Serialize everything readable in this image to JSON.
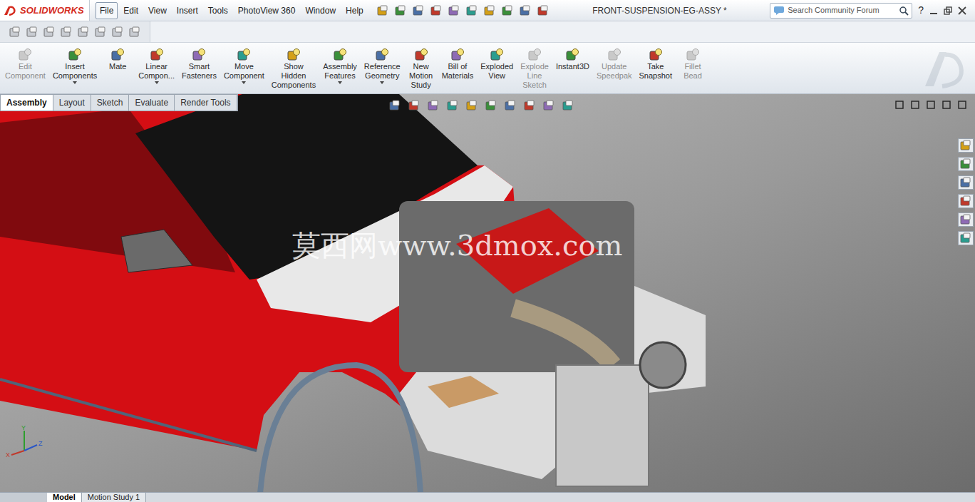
{
  "app": {
    "logo": "SOLIDWORKS"
  },
  "window": {
    "title": "FRONT-SUSPENSION-EG-ASSY *"
  },
  "menu": [
    {
      "label": "File",
      "selected": true
    },
    {
      "label": "Edit",
      "selected": false
    },
    {
      "label": "View",
      "selected": false
    },
    {
      "label": "Insert",
      "selected": false
    },
    {
      "label": "Tools",
      "selected": false
    },
    {
      "label": "PhotoView 360",
      "selected": false
    },
    {
      "label": "Window",
      "selected": false
    },
    {
      "label": "Help",
      "selected": false
    }
  ],
  "search": {
    "placeholder": "Search Community Forum"
  },
  "help": "?",
  "commands": [
    {
      "lines": [
        "Edit",
        "Component"
      ],
      "disabled": true,
      "dropdown": false
    },
    {
      "lines": [
        "Insert",
        "Components"
      ],
      "disabled": false,
      "dropdown": true
    },
    {
      "lines": [
        "Mate"
      ],
      "disabled": false,
      "dropdown": false
    },
    {
      "lines": [
        "Linear",
        "Compon..."
      ],
      "disabled": false,
      "dropdown": true
    },
    {
      "lines": [
        "Smart",
        "Fasteners"
      ],
      "disabled": false,
      "dropdown": false
    },
    {
      "lines": [
        "Move",
        "Component"
      ],
      "disabled": false,
      "dropdown": true
    },
    {
      "lines": [
        "Show",
        "Hidden",
        "Components"
      ],
      "disabled": false,
      "dropdown": false
    },
    {
      "lines": [
        "Assembly",
        "Features"
      ],
      "disabled": false,
      "dropdown": true
    },
    {
      "lines": [
        "Reference",
        "Geometry"
      ],
      "disabled": false,
      "dropdown": true
    },
    {
      "lines": [
        "New",
        "Motion",
        "Study"
      ],
      "disabled": false,
      "dropdown": false
    },
    {
      "lines": [
        "Bill of",
        "Materials"
      ],
      "disabled": false,
      "dropdown": false
    },
    {
      "lines": [
        "Exploded",
        "View"
      ],
      "disabled": false,
      "dropdown": false
    },
    {
      "lines": [
        "Explode",
        "Line",
        "Sketch"
      ],
      "disabled": true,
      "dropdown": false
    },
    {
      "lines": [
        "Instant3D"
      ],
      "disabled": false,
      "dropdown": false
    },
    {
      "lines": [
        "Update",
        "Speedpak"
      ],
      "disabled": true,
      "dropdown": false
    },
    {
      "lines": [
        "Take",
        "Snapshot"
      ],
      "disabled": false,
      "dropdown": false
    },
    {
      "lines": [
        "Fillet",
        "Bead"
      ],
      "disabled": true,
      "dropdown": false
    }
  ],
  "tabs": [
    {
      "label": "Assembly",
      "selected": true
    },
    {
      "label": "Layout",
      "selected": false
    },
    {
      "label": "Sketch",
      "selected": false
    },
    {
      "label": "Evaluate",
      "selected": false
    },
    {
      "label": "Render Tools",
      "selected": false
    }
  ],
  "watermark": "莫西网www.3dmox.com",
  "triad": {
    "x": "X",
    "y": "Y",
    "z": "Z"
  },
  "bottom_tabs": [
    {
      "label": "Model",
      "selected": true
    },
    {
      "label": "Motion Study 1",
      "selected": false
    }
  ]
}
